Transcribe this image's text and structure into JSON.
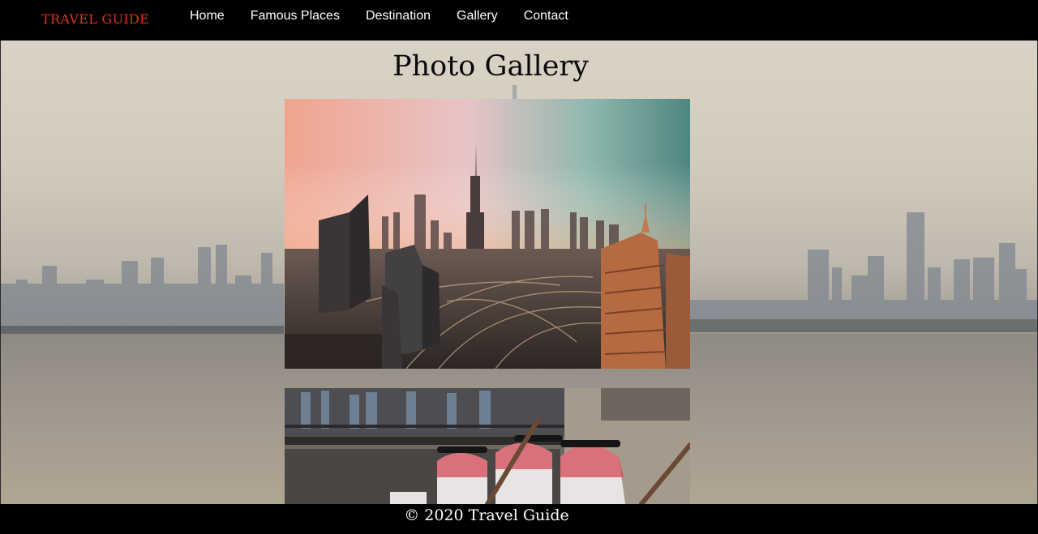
{
  "brand": "TRAVEL GUIDE",
  "nav": {
    "items": [
      {
        "label": "Home"
      },
      {
        "label": "Famous Places"
      },
      {
        "label": "Destination"
      },
      {
        "label": "Gallery"
      },
      {
        "label": "Contact"
      }
    ]
  },
  "main": {
    "title": "Photo Gallery"
  },
  "footer": {
    "text": "© 2020 Travel Guide"
  },
  "colors": {
    "brand": "#e0301e",
    "bar": "#000000"
  }
}
